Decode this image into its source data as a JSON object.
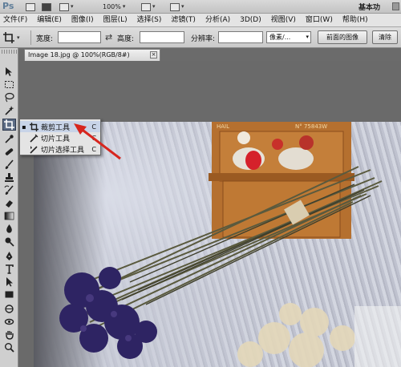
{
  "app": {
    "logo": "Ps"
  },
  "app_bar": {
    "zoom": "100%",
    "workspace": "基本功"
  },
  "menu": {
    "items": [
      "文件(F)",
      "编辑(E)",
      "图像(I)",
      "图层(L)",
      "选择(S)",
      "滤镜(T)",
      "分析(A)",
      "3D(D)",
      "视图(V)",
      "窗口(W)",
      "帮助(H)"
    ]
  },
  "options_bar": {
    "width_label": "宽度:",
    "width_value": "",
    "height_label": "高度:",
    "height_value": "",
    "resolution_label": "分辨率:",
    "resolution_value": "",
    "unit_select": "像素/...",
    "front_image_button": "前面的图像",
    "clear_button": "清除"
  },
  "document": {
    "tab_title": "Image 18.jpg @ 100%(RGB/8#)",
    "close_glyph": "×"
  },
  "flyout": {
    "items": [
      {
        "bullet": "▪",
        "label": "裁剪工具",
        "key": "C"
      },
      {
        "bullet": "",
        "label": "切片工具",
        "key": "C"
      },
      {
        "bullet": "",
        "label": "切片选择工具",
        "key": "C"
      }
    ]
  },
  "photo": {
    "sign_text": "N° 75843W",
    "sign_text2": "HAIL"
  },
  "colors": {
    "accent_arrow": "#d7261e",
    "active_tool": "#5c6c85",
    "panel_bg": "#cfcfcf",
    "canvas_bg": "#6a6a6a"
  }
}
